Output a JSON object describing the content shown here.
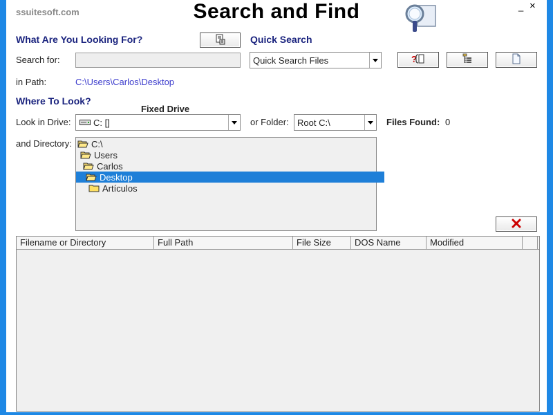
{
  "window": {
    "brand": "ssuitesoft.com",
    "title": "Search and Find",
    "minimize": "_",
    "close": "×"
  },
  "search": {
    "section_title": "What Are You Looking For?",
    "search_for_label": "Search for:",
    "search_value": "",
    "in_path_label": "in Path:",
    "path_value": "C:\\Users\\Carlos\\Desktop"
  },
  "quick": {
    "section_title": "Quick Search",
    "selected": "Quick Search Files"
  },
  "where": {
    "section_title": "Where To Look?",
    "drive_type": "Fixed Drive",
    "look_in_drive_label": "Look in Drive:",
    "drive_value": "C: []",
    "or_folder_label": "or Folder:",
    "folder_value": "Root C:\\",
    "files_found_label": "Files Found:",
    "files_found_value": "0",
    "directory_label": "and Directory:"
  },
  "tree": [
    {
      "label": "C:\\",
      "open": true,
      "selected": false
    },
    {
      "label": "Users",
      "open": true,
      "selected": false
    },
    {
      "label": "Carlos",
      "open": true,
      "selected": false
    },
    {
      "label": "Desktop",
      "open": true,
      "selected": true
    },
    {
      "label": "Artículos",
      "open": false,
      "selected": false
    }
  ],
  "results": {
    "columns": [
      "Filename or Directory",
      "Full Path",
      "File Size",
      "DOS Name",
      "Modified"
    ],
    "rows": []
  },
  "icons": {
    "options_button": "document-tree-icon",
    "help_button": "help-icon",
    "tree_view_button": "tree-view-icon",
    "blank_page_button": "blank-page-icon",
    "clear_button": "red-x-icon",
    "logo": "magnifier-logo-icon"
  },
  "colors": {
    "frame": "#1e88e5",
    "section_heading": "#1a237e",
    "path_link": "#3b3bcc",
    "selection": "#1e7fd8",
    "clear_x": "#cc0000"
  }
}
